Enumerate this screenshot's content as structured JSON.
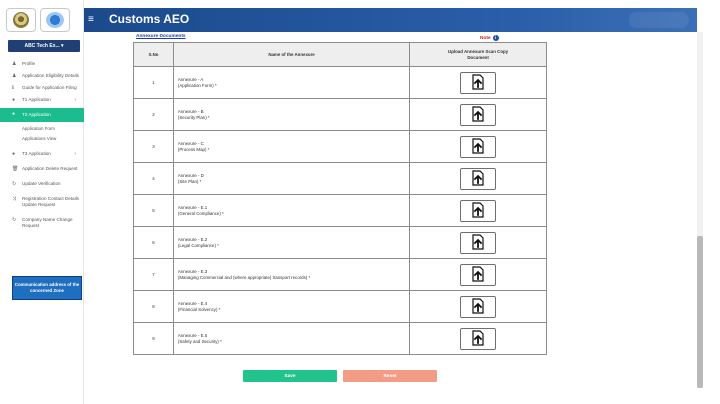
{
  "header": {
    "title": "Customs AEO",
    "menu_icon": "hamburger-icon"
  },
  "sidebar": {
    "company": "ABC Tech Ex... ▾",
    "items": [
      {
        "label": "Profile",
        "icon": "user-icon"
      },
      {
        "label": "Application Eligibility Details",
        "icon": "user-icon"
      },
      {
        "label": "Guide for Application Filing",
        "icon": "info-icon"
      },
      {
        "label": "T1 Application",
        "icon": "circle-icon",
        "chevron": "›"
      },
      {
        "label": "T2 Application",
        "icon": "circle-icon",
        "active": true
      },
      {
        "label": "T3 Application",
        "icon": "circle-icon",
        "chevron": "›"
      },
      {
        "label": "Application Delete Request",
        "icon": "trash-icon"
      },
      {
        "label": "Update Verification",
        "icon": "refresh-icon"
      },
      {
        "label": "Registration Contact Details Update Request",
        "icon": "shuffle-icon"
      },
      {
        "label": "Company Name Change Request",
        "icon": "refresh-icon"
      }
    ],
    "t2_sub": [
      "Application Form",
      "Applications View"
    ],
    "notice": "Communication address of the concerned Zone"
  },
  "content": {
    "section_title": "Annexure Documents",
    "note_label": "Note",
    "table": {
      "headers": [
        "S.No",
        "Name of the Annexure",
        "Upload Annexure Scan Copy Document"
      ],
      "rows": [
        {
          "sno": "1",
          "name": "Annexure - A",
          "sub": "(Application Form) *"
        },
        {
          "sno": "2",
          "name": "Annexure - B",
          "sub": "(Security Plan) *"
        },
        {
          "sno": "3",
          "name": "Annexure - C",
          "sub": "(Process Map) *"
        },
        {
          "sno": "4",
          "name": "Annexure - D",
          "sub": "(Site Plan) *"
        },
        {
          "sno": "5",
          "name": "Annexure - E.1",
          "sub": "(General Compliance) *"
        },
        {
          "sno": "6",
          "name": "Annexure - E.2",
          "sub": "(Legal Compliance) *"
        },
        {
          "sno": "7",
          "name": "Annexure - E.3",
          "sub": "(Managing Commercial and (where appropriate) transport records) *"
        },
        {
          "sno": "8",
          "name": "Annexure - E.4",
          "sub": "(Financial Solvency) *"
        },
        {
          "sno": "9",
          "name": "Annexure - E.5",
          "sub": "(Safety and Security) *"
        }
      ]
    },
    "save_label": "Save",
    "reset_label": "Reset"
  },
  "colors": {
    "header": "#1b4a8c",
    "active": "#1bbd8e",
    "save": "#22c38c",
    "reset": "#f29b85"
  }
}
